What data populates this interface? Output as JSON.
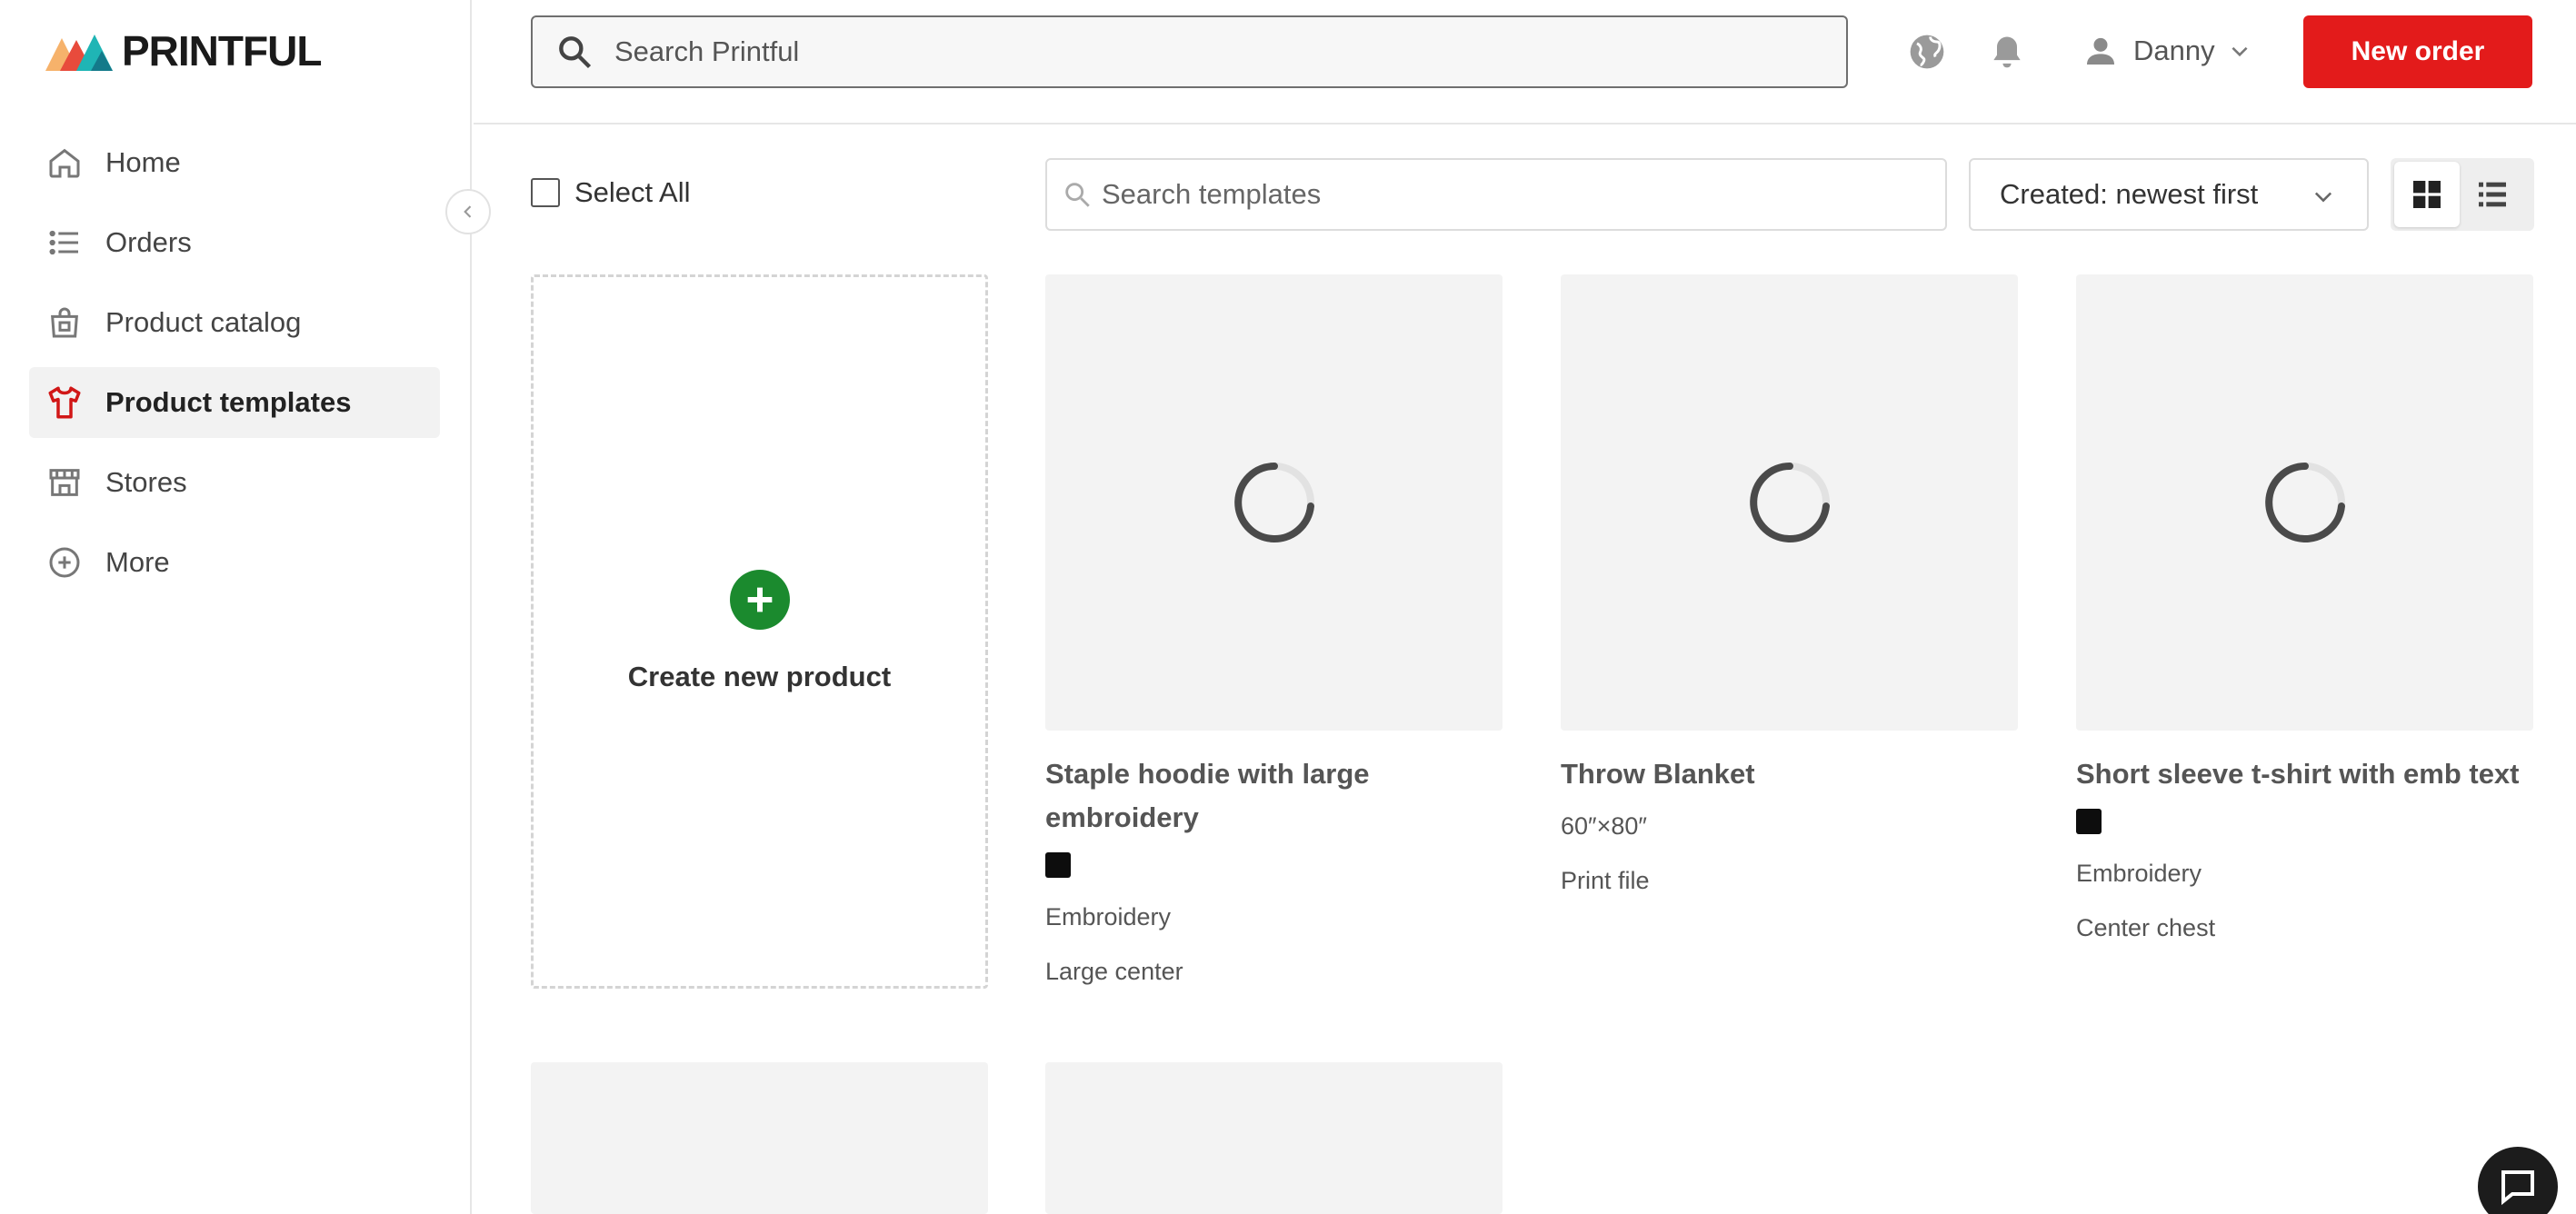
{
  "brand": {
    "name": "PRINTFUL",
    "colors": {
      "accent": "#e31b1b",
      "create": "#1b8a2e",
      "active_nav_icon": "#d11717"
    }
  },
  "sidebar": {
    "items": [
      {
        "label": "Home",
        "icon": "home-icon"
      },
      {
        "label": "Orders",
        "icon": "list-icon"
      },
      {
        "label": "Product catalog",
        "icon": "shopping-bag-icon"
      },
      {
        "label": "Product templates",
        "icon": "t-shirt-icon",
        "active": true
      },
      {
        "label": "Stores",
        "icon": "store-icon"
      },
      {
        "label": "More",
        "icon": "plus-circle-icon"
      }
    ]
  },
  "header": {
    "search_placeholder": "Search Printful",
    "user_name": "Danny",
    "new_order_label": "New order"
  },
  "toolbar": {
    "select_all_label": "Select All",
    "search_placeholder": "Search templates",
    "sort_label": "Created: newest first"
  },
  "create_card": {
    "label": "Create new product"
  },
  "templates": [
    {
      "title": "Staple hoodie with large embroidery",
      "has_swatch": true,
      "technique": "Embroidery",
      "placement": "Large center"
    },
    {
      "title": "Throw Blanket",
      "size": "60″×80″",
      "file": "Print file"
    },
    {
      "title": "Short sleeve t-shirt with emb text",
      "has_swatch": true,
      "technique": "Embroidery",
      "placement": "Center chest"
    }
  ]
}
